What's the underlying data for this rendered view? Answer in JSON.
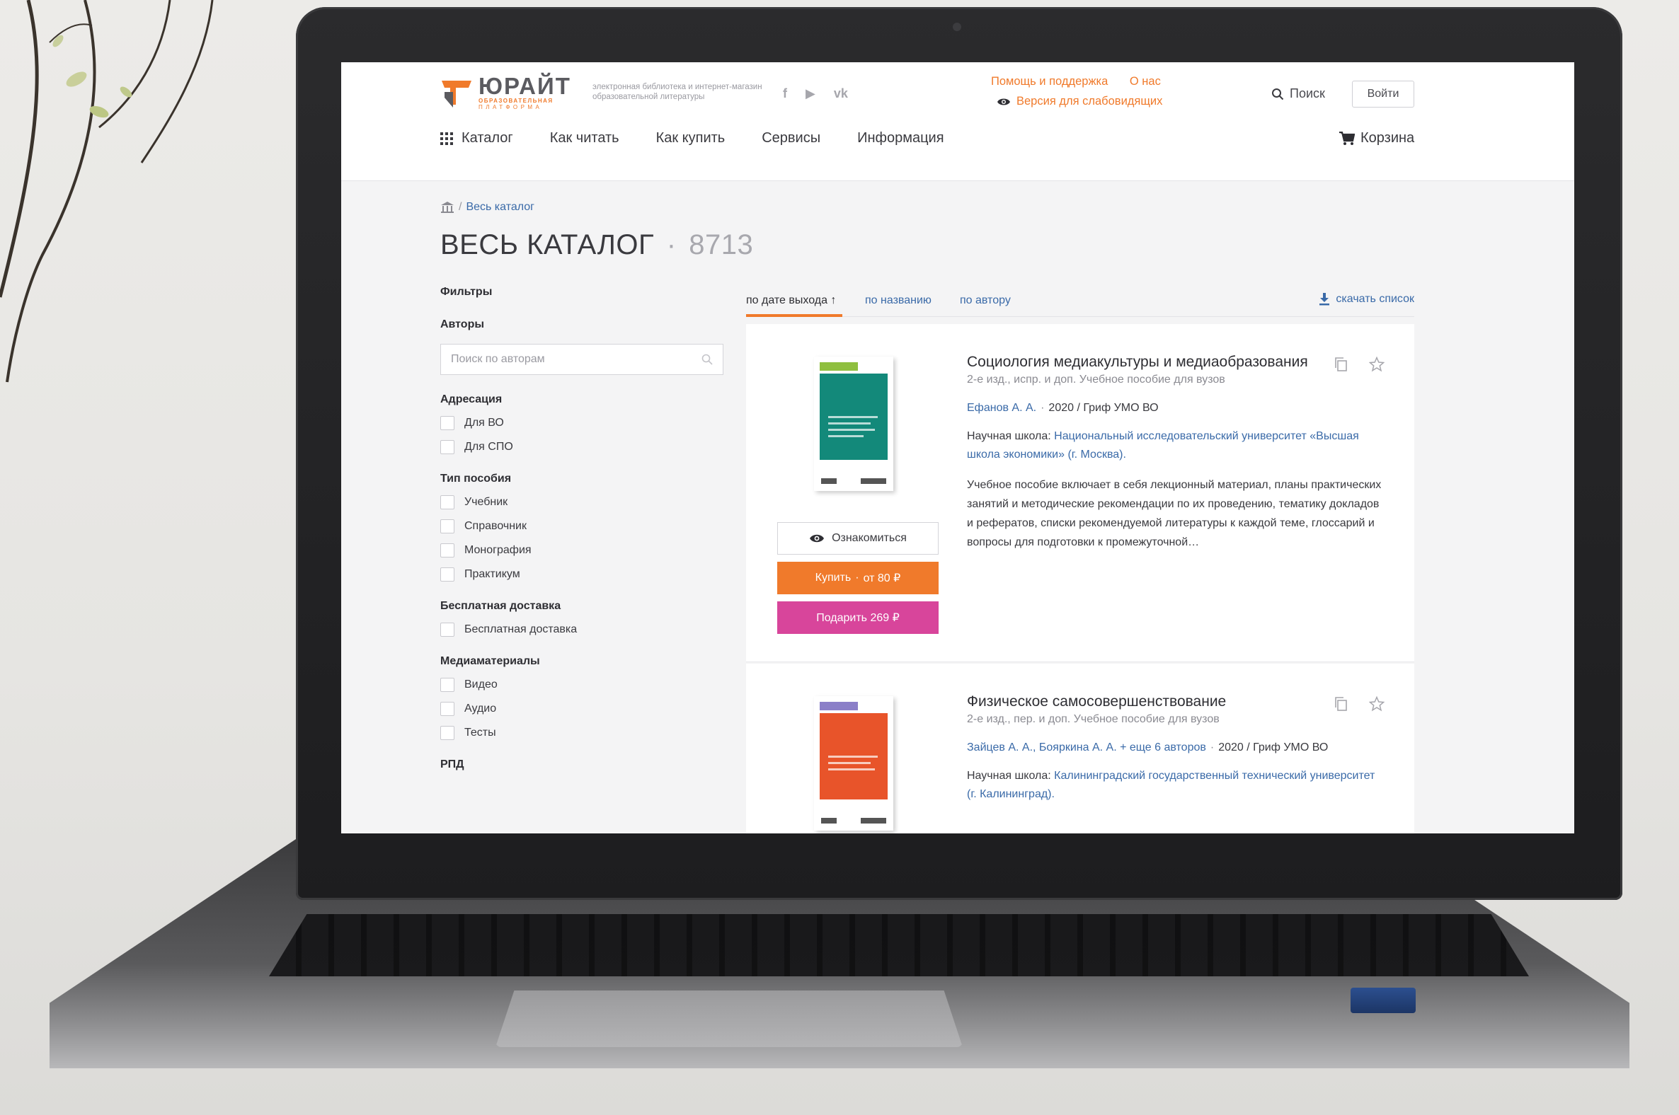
{
  "brand": {
    "name": "ЮРАЙТ",
    "subtitle_1": "ОБРАЗОВАТЕЛЬНАЯ",
    "subtitle_2": "ПЛАТФОРМА",
    "tagline": "электронная библиотека и интернет-магазин образовательной литературы",
    "accent_color": "#f07a2b"
  },
  "socials": [
    "f",
    "▶",
    "vk"
  ],
  "top_links": {
    "help": "Помощь и поддержка",
    "about": "О нас",
    "low_vision": "Версия для слабовидящих"
  },
  "header_actions": {
    "search": "Поиск",
    "login": "Войти"
  },
  "nav": {
    "catalog": "Каталог",
    "how_to_read": "Как читать",
    "how_to_buy": "Как купить",
    "services": "Сервисы",
    "info": "Информация",
    "cart": "Корзина"
  },
  "breadcrumb": {
    "separator": "/",
    "current": "Весь каталог"
  },
  "page": {
    "title": "ВЕСЬ КАТАЛОГ",
    "separator": "·",
    "count": "8713"
  },
  "filters": {
    "title": "Фильтры",
    "authors": {
      "title": "Авторы",
      "placeholder": "Поиск по авторам"
    },
    "address": {
      "title": "Адресация",
      "options": [
        "Для ВО",
        "Для СПО"
      ]
    },
    "type": {
      "title": "Тип пособия",
      "options": [
        "Учебник",
        "Справочник",
        "Монография",
        "Практикум"
      ]
    },
    "delivery": {
      "title": "Бесплатная доставка",
      "options": [
        "Бесплатная доставка"
      ]
    },
    "media": {
      "title": "Медиаматериалы",
      "options": [
        "Видео",
        "Аудио",
        "Тесты"
      ]
    },
    "rpd": {
      "title": "РПД"
    }
  },
  "sort": {
    "by_date": "по дате выхода ↑",
    "by_name": "по названию",
    "by_author": "по автору",
    "download": "скачать список"
  },
  "books": [
    {
      "title": "Социология медиакультуры и медиаобразования",
      "edition": "2-е изд., испр. и доп. Учебное пособие для вузов",
      "authors": "Ефанов А. А.",
      "more_authors": "",
      "year": "2020",
      "grif": "/ Гриф УМО ВО",
      "school_label": "Научная школа:",
      "school": "Национальный исследовательский университет «Высшая школа экономики» (г. Москва).",
      "description": "Учебное пособие включает в себя лекционный материал, планы практических занятий и методические рекомендации по их проведению, тематику докладов и рефератов, списки рекомендуемой литературы к каждой теме, глоссарий и вопросы для подготовки к промежуточной…",
      "preview_label": "Ознакомиться",
      "buy_label": "Купить",
      "buy_price": "от 80 ₽",
      "gift_label": "Подарить 269 ₽",
      "cover_color": "#13897a"
    },
    {
      "title": "Физическое самосовершенствование",
      "edition": "2-е изд., пер. и доп. Учебное пособие для вузов",
      "authors": "Зайцев А. А., Бояркина А. А.",
      "more_authors": "+ еще 6 авторов",
      "year": "2020",
      "grif": "/ Гриф УМО ВО",
      "school_label": "Научная школа:",
      "school": "Калининградский государственный технический университет (г. Калининград).",
      "cover_color": "#e8542a"
    }
  ]
}
